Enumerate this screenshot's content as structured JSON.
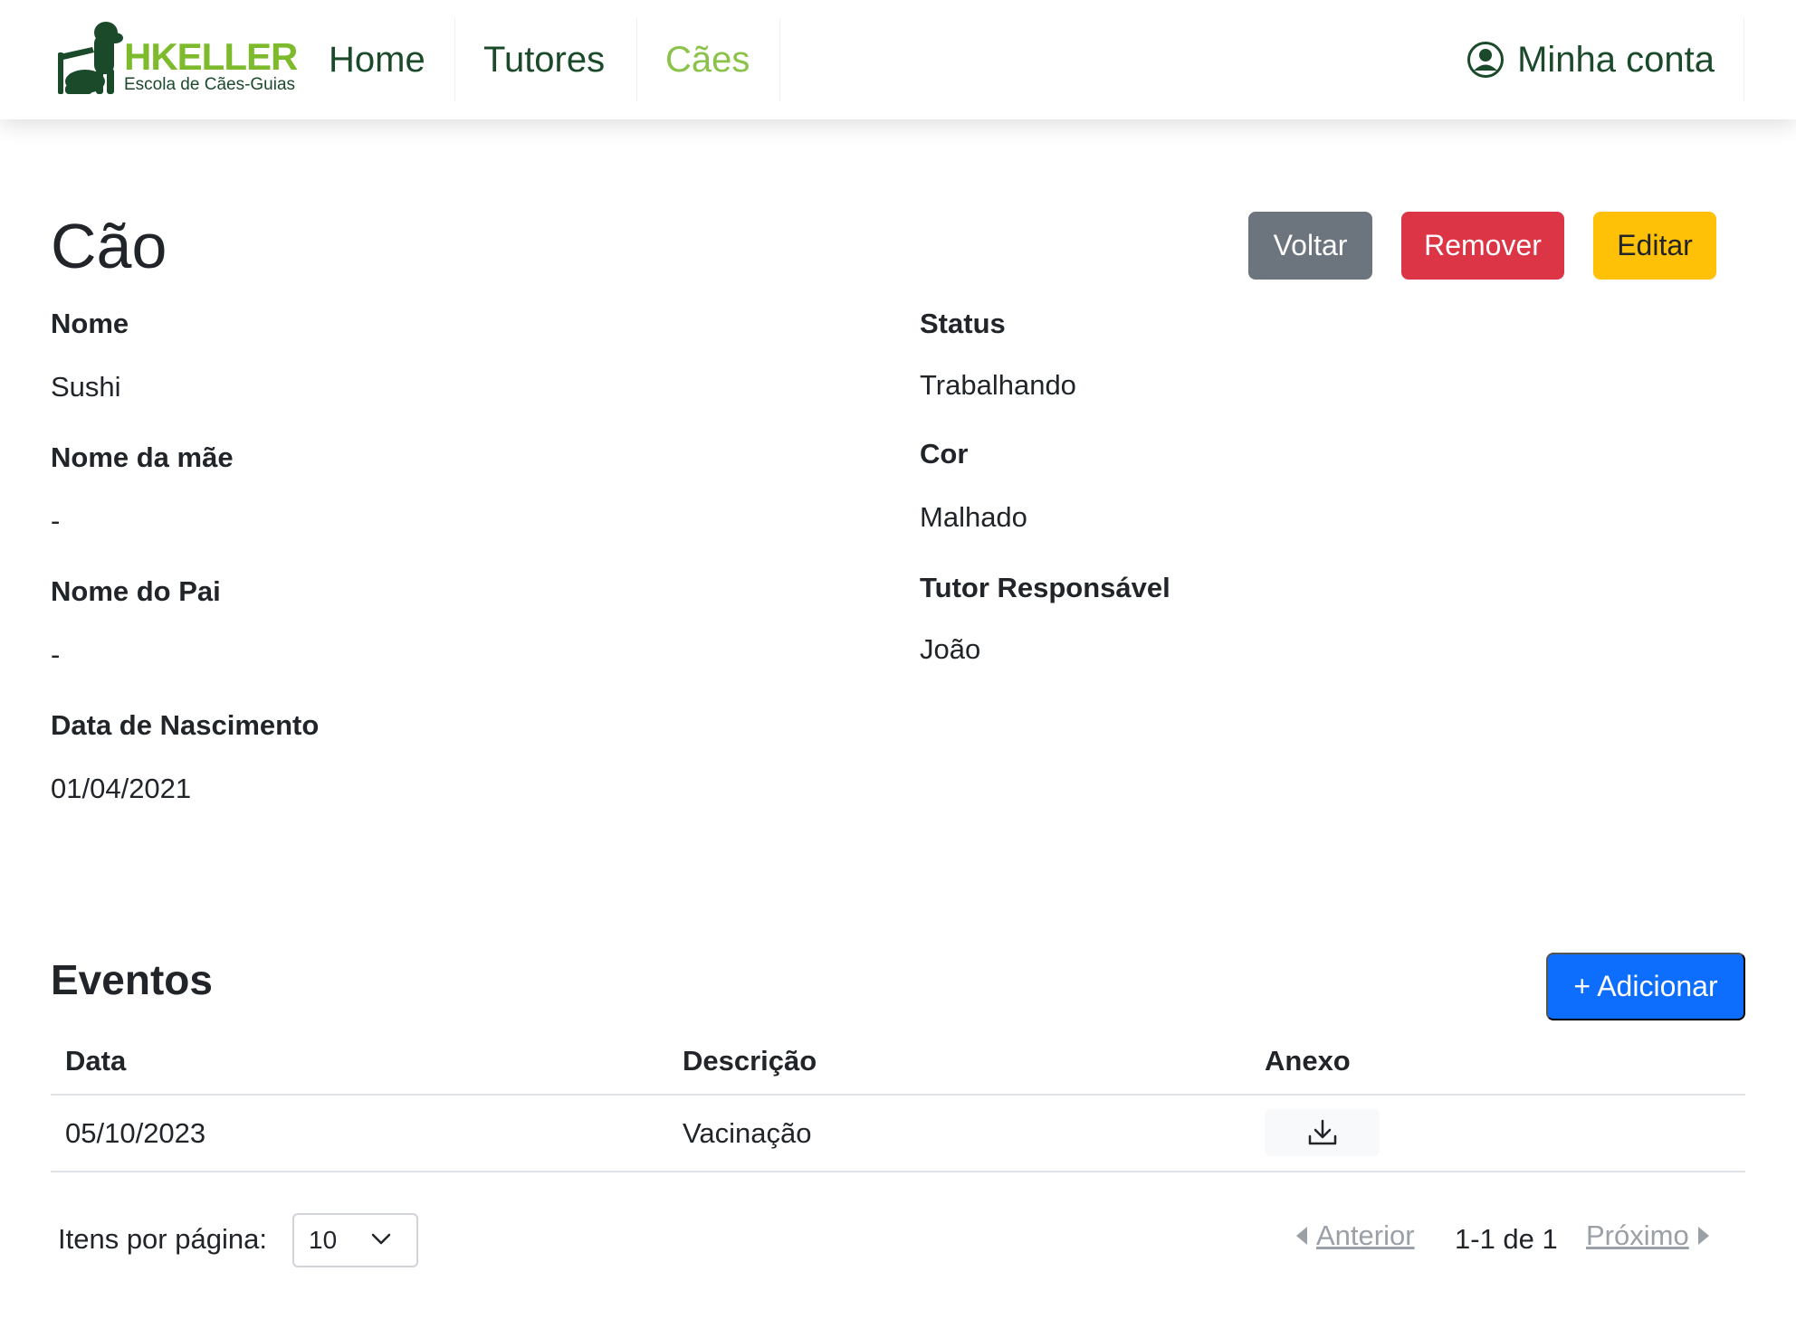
{
  "navbar": {
    "logo": {
      "brand": "HKELLER",
      "tagline": "Escola de Cães-Guias"
    },
    "items": [
      {
        "label": "Home"
      },
      {
        "label": "Tutores"
      },
      {
        "label": "Cães",
        "active": true
      }
    ],
    "account_label": "Minha conta"
  },
  "page": {
    "title": "Cão",
    "buttons": {
      "back": "Voltar",
      "remove": "Remover",
      "edit": "Editar"
    }
  },
  "fields": {
    "nome": {
      "label": "Nome",
      "value": "Sushi"
    },
    "nome_mae": {
      "label": "Nome da mãe",
      "value": "-"
    },
    "nome_pai": {
      "label": "Nome do Pai",
      "value": "-"
    },
    "data_nascimento": {
      "label": "Data de Nascimento",
      "value": "01/04/2021"
    },
    "status": {
      "label": "Status",
      "value": "Trabalhando"
    },
    "cor": {
      "label": "Cor",
      "value": "Malhado"
    },
    "tutor": {
      "label": "Tutor Responsável",
      "value": "João"
    }
  },
  "events": {
    "title": "Eventos",
    "add_button": "+ Adicionar",
    "columns": [
      "Data",
      "Descrição",
      "Anexo"
    ],
    "rows": [
      {
        "data": "05/10/2023",
        "descricao": "Vacinação",
        "anexo_icon": "download-icon"
      }
    ]
  },
  "pagination": {
    "per_page_label": "Itens por página:",
    "per_page_value": "10",
    "prev": "Anterior",
    "info": "1-1 de 1",
    "next": "Próximo"
  },
  "colors": {
    "nav_text": "#1b4a2b",
    "nav_active": "#8bc34a",
    "btn_back": "#6c757d",
    "btn_remove": "#dc3545",
    "btn_edit": "#ffc107",
    "btn_add": "#0d6efd"
  }
}
